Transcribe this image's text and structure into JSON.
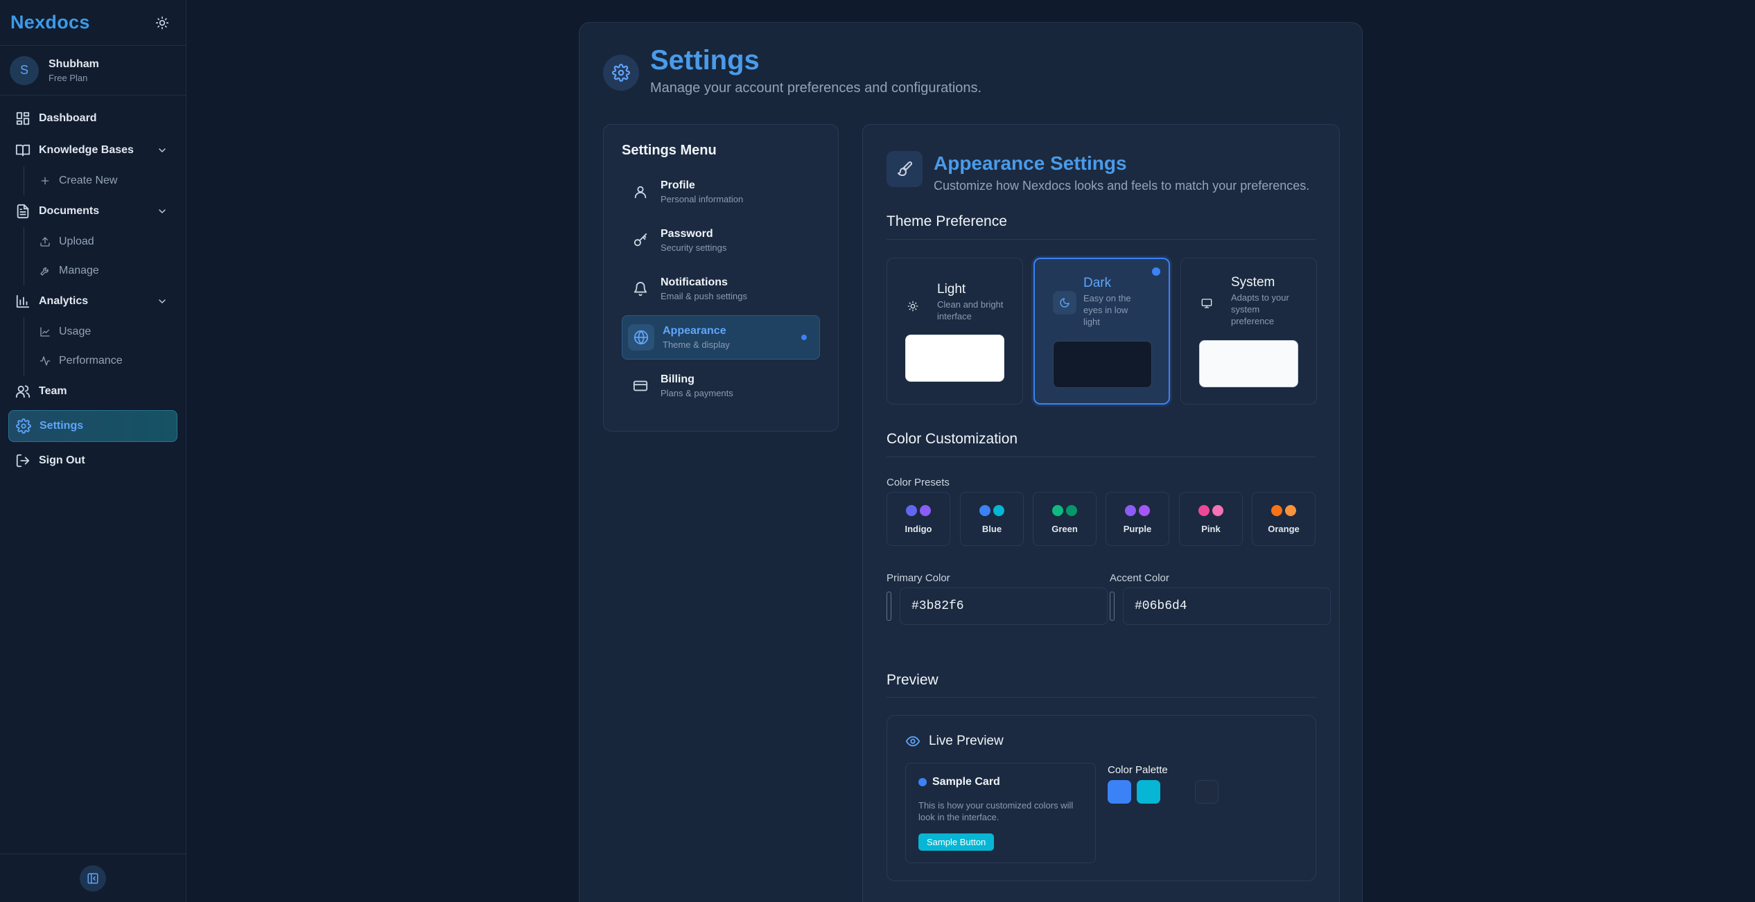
{
  "sidebar": {
    "brand": "Nexdocs",
    "user": {
      "initial": "S",
      "name": "Shubham",
      "plan": "Free Plan"
    },
    "items": [
      {
        "label": "Dashboard"
      },
      {
        "label": "Knowledge Bases",
        "children": [
          {
            "label": "Create New"
          }
        ]
      },
      {
        "label": "Documents",
        "children": [
          {
            "label": "Upload"
          },
          {
            "label": "Manage"
          }
        ]
      },
      {
        "label": "Analytics",
        "children": [
          {
            "label": "Usage"
          },
          {
            "label": "Performance"
          }
        ]
      },
      {
        "label": "Team"
      },
      {
        "label": "Settings",
        "active": true
      },
      {
        "label": "Sign Out"
      }
    ]
  },
  "page": {
    "title": "Settings",
    "subtitle": "Manage your account preferences and configurations."
  },
  "menu": {
    "title": "Settings Menu",
    "items": [
      {
        "label": "Profile",
        "desc": "Personal information",
        "icon": "user-icon"
      },
      {
        "label": "Password",
        "desc": "Security settings",
        "icon": "key-icon"
      },
      {
        "label": "Notifications",
        "desc": "Email & push settings",
        "icon": "bell-icon"
      },
      {
        "label": "Appearance",
        "desc": "Theme & display",
        "icon": "globe-icon",
        "active": true
      },
      {
        "label": "Billing",
        "desc": "Plans & payments",
        "icon": "credit-card-icon"
      }
    ]
  },
  "appearance": {
    "title": "Appearance Settings",
    "subtitle": "Customize how Nexdocs looks and feels to match your preferences.",
    "theme_section": "Theme Preference",
    "themes": [
      {
        "name": "Light",
        "desc": "Clean and bright interface",
        "icon": "sun-icon",
        "swatch": "#ffffff"
      },
      {
        "name": "Dark",
        "desc": "Easy on the eyes in low light",
        "icon": "moon-icon",
        "swatch": "#111a2b",
        "selected": true
      },
      {
        "name": "System",
        "desc": "Adapts to your system preference",
        "icon": "monitor-icon",
        "swatch": "#f8fafc"
      }
    ],
    "color_section": "Color Customization",
    "presets_label": "Color Presets",
    "presets": [
      {
        "name": "Indigo",
        "colors": [
          "#6366f1",
          "#8b5cf6"
        ]
      },
      {
        "name": "Blue",
        "colors": [
          "#3b82f6",
          "#06b6d4"
        ]
      },
      {
        "name": "Green",
        "colors": [
          "#10b981",
          "#059669"
        ]
      },
      {
        "name": "Purple",
        "colors": [
          "#8b5cf6",
          "#a855f7"
        ]
      },
      {
        "name": "Pink",
        "colors": [
          "#ec4899",
          "#f472b6"
        ]
      },
      {
        "name": "Orange",
        "colors": [
          "#f97316",
          "#fb923c"
        ]
      }
    ],
    "primary_label": "Primary Color",
    "primary_value": "#3b82f6",
    "accent_label": "Accent Color",
    "accent_value": "#06b6d4",
    "preview_section": "Preview",
    "live_preview": {
      "title": "Live Preview",
      "card_title": "Sample Card",
      "card_text": "This is how your customized colors will look in the interface.",
      "button_label": "Sample Button",
      "palette_title": "Color Palette",
      "palette": [
        "#3b82f6",
        "#06b6d4",
        "#1b2a40",
        "#1e2b40"
      ]
    }
  }
}
